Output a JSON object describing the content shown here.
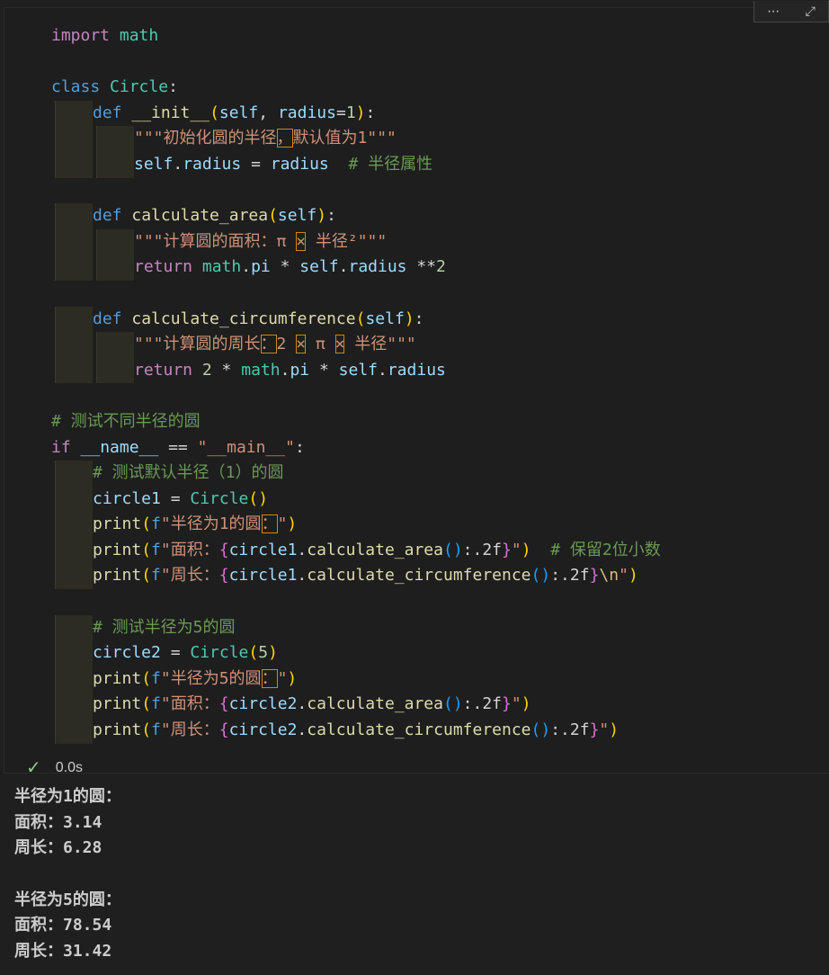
{
  "cell": {
    "toolbar_icons": [
      "more-actions-icon",
      "expand-icon"
    ],
    "code_lines": [
      {
        "guides": 0,
        "tokens": [
          [
            "ctl",
            "import"
          ],
          [
            "op",
            " "
          ],
          [
            "cls",
            "math"
          ]
        ]
      },
      {
        "guides": 0,
        "tokens": []
      },
      {
        "guides": 0,
        "tokens": [
          [
            "kw",
            "class"
          ],
          [
            "op",
            " "
          ],
          [
            "cls",
            "Circle"
          ],
          [
            "op",
            ":"
          ]
        ]
      },
      {
        "guides": 1,
        "tokens": [
          [
            "kw",
            "def"
          ],
          [
            "op",
            " "
          ],
          [
            "fn",
            "__init__"
          ],
          [
            "b1",
            "("
          ],
          [
            "var",
            "self"
          ],
          [
            "op",
            ", "
          ],
          [
            "var",
            "radius"
          ],
          [
            "op",
            "="
          ],
          [
            "num",
            "1"
          ],
          [
            "b1",
            ")"
          ],
          [
            "op",
            ":"
          ]
        ]
      },
      {
        "guides": 2,
        "tokens": [
          [
            "str",
            "\"\"\"初始化圆的半径"
          ],
          [
            "str hl",
            "，"
          ],
          [
            "str",
            "默认值为1\"\"\""
          ]
        ]
      },
      {
        "guides": 2,
        "tokens": [
          [
            "var",
            "self"
          ],
          [
            "op",
            "."
          ],
          [
            "var",
            "radius"
          ],
          [
            "op",
            " = "
          ],
          [
            "var",
            "radius"
          ],
          [
            "op",
            "  "
          ],
          [
            "com",
            "# 半径属性"
          ]
        ]
      },
      {
        "guides": 0,
        "tokens": []
      },
      {
        "guides": 1,
        "tokens": [
          [
            "kw",
            "def"
          ],
          [
            "op",
            " "
          ],
          [
            "fn",
            "calculate_area"
          ],
          [
            "b1",
            "("
          ],
          [
            "var",
            "self"
          ],
          [
            "b1",
            ")"
          ],
          [
            "op",
            ":"
          ]
        ]
      },
      {
        "guides": 2,
        "tokens": [
          [
            "str",
            "\"\"\"计算圆的面积：π "
          ],
          [
            "str hl",
            "×"
          ],
          [
            "str",
            " 半径²\"\"\""
          ]
        ]
      },
      {
        "guides": 2,
        "tokens": [
          [
            "ctl",
            "return"
          ],
          [
            "op",
            " "
          ],
          [
            "cls",
            "math"
          ],
          [
            "op",
            "."
          ],
          [
            "var",
            "pi"
          ],
          [
            "op",
            " * "
          ],
          [
            "var",
            "self"
          ],
          [
            "op",
            "."
          ],
          [
            "var",
            "radius"
          ],
          [
            "op",
            " **"
          ],
          [
            "num",
            "2"
          ]
        ]
      },
      {
        "guides": 0,
        "tokens": []
      },
      {
        "guides": 1,
        "tokens": [
          [
            "kw",
            "def"
          ],
          [
            "op",
            " "
          ],
          [
            "fn",
            "calculate_circumference"
          ],
          [
            "b1",
            "("
          ],
          [
            "var",
            "self"
          ],
          [
            "b1",
            ")"
          ],
          [
            "op",
            ":"
          ]
        ]
      },
      {
        "guides": 2,
        "tokens": [
          [
            "str",
            "\"\"\"计算圆的周长"
          ],
          [
            "str hl",
            "："
          ],
          [
            "str",
            "2 "
          ],
          [
            "str hl",
            "×"
          ],
          [
            "str",
            " π "
          ],
          [
            "str hl",
            "×"
          ],
          [
            "str",
            " 半径\"\"\""
          ]
        ]
      },
      {
        "guides": 2,
        "tokens": [
          [
            "ctl",
            "return"
          ],
          [
            "op",
            " "
          ],
          [
            "num",
            "2"
          ],
          [
            "op",
            " * "
          ],
          [
            "cls",
            "math"
          ],
          [
            "op",
            "."
          ],
          [
            "var",
            "pi"
          ],
          [
            "op",
            " * "
          ],
          [
            "var",
            "self"
          ],
          [
            "op",
            "."
          ],
          [
            "var",
            "radius"
          ]
        ]
      },
      {
        "guides": 0,
        "tokens": []
      },
      {
        "guides": 0,
        "tokens": [
          [
            "com",
            "# 测试不同半径的圆"
          ]
        ]
      },
      {
        "guides": 0,
        "tokens": [
          [
            "ctl",
            "if"
          ],
          [
            "op",
            " "
          ],
          [
            "var",
            "__name__"
          ],
          [
            "op",
            " == "
          ],
          [
            "str",
            "\"__main__\""
          ],
          [
            "op",
            ":"
          ]
        ]
      },
      {
        "guides": 1,
        "tokens": [
          [
            "com",
            "# 测试默认半径（1）的圆"
          ]
        ]
      },
      {
        "guides": 1,
        "tokens": [
          [
            "var",
            "circle1"
          ],
          [
            "op",
            " = "
          ],
          [
            "cls",
            "Circle"
          ],
          [
            "b1",
            "()"
          ]
        ]
      },
      {
        "guides": 1,
        "tokens": [
          [
            "fn",
            "print"
          ],
          [
            "b1",
            "("
          ],
          [
            "kw",
            "f"
          ],
          [
            "str",
            "\"半径为1的圆"
          ],
          [
            "str hl",
            "："
          ],
          [
            "str",
            "\""
          ],
          [
            "b1",
            ")"
          ]
        ]
      },
      {
        "guides": 1,
        "tokens": [
          [
            "fn",
            "print"
          ],
          [
            "b1",
            "("
          ],
          [
            "kw",
            "f"
          ],
          [
            "str",
            "\"面积："
          ],
          [
            "b2",
            "{"
          ],
          [
            "var",
            "circle1"
          ],
          [
            "op",
            "."
          ],
          [
            "fn",
            "calculate_area"
          ],
          [
            "b3",
            "()"
          ],
          [
            "op",
            ":.2f"
          ],
          [
            "b2",
            "}"
          ],
          [
            "str",
            "\""
          ],
          [
            "b1",
            ")"
          ],
          [
            "op",
            "  "
          ],
          [
            "com",
            "# 保留2位小数"
          ]
        ]
      },
      {
        "guides": 1,
        "tokens": [
          [
            "fn",
            "print"
          ],
          [
            "b1",
            "("
          ],
          [
            "kw",
            "f"
          ],
          [
            "str",
            "\"周长："
          ],
          [
            "b2",
            "{"
          ],
          [
            "var",
            "circle1"
          ],
          [
            "op",
            "."
          ],
          [
            "fn",
            "calculate_circumference"
          ],
          [
            "b3",
            "()"
          ],
          [
            "op",
            ":.2f"
          ],
          [
            "b2",
            "}"
          ],
          [
            "esc",
            "\\n"
          ],
          [
            "str",
            "\""
          ],
          [
            "b1",
            ")"
          ]
        ]
      },
      {
        "guides": 0,
        "tokens": []
      },
      {
        "guides": 1,
        "tokens": [
          [
            "com",
            "# 测试半径为5的圆"
          ]
        ]
      },
      {
        "guides": 1,
        "tokens": [
          [
            "var",
            "circle2"
          ],
          [
            "op",
            " = "
          ],
          [
            "cls",
            "Circle"
          ],
          [
            "b1",
            "("
          ],
          [
            "num",
            "5"
          ],
          [
            "b1",
            ")"
          ]
        ]
      },
      {
        "guides": 1,
        "tokens": [
          [
            "fn",
            "print"
          ],
          [
            "b1",
            "("
          ],
          [
            "kw",
            "f"
          ],
          [
            "str",
            "\"半径为5的圆"
          ],
          [
            "str hl",
            "："
          ],
          [
            "str",
            "\""
          ],
          [
            "b1",
            ")"
          ]
        ]
      },
      {
        "guides": 1,
        "tokens": [
          [
            "fn",
            "print"
          ],
          [
            "b1",
            "("
          ],
          [
            "kw",
            "f"
          ],
          [
            "str",
            "\"面积："
          ],
          [
            "b2",
            "{"
          ],
          [
            "var",
            "circle2"
          ],
          [
            "op",
            "."
          ],
          [
            "fn",
            "calculate_area"
          ],
          [
            "b3",
            "()"
          ],
          [
            "op",
            ":.2f"
          ],
          [
            "b2",
            "}"
          ],
          [
            "str",
            "\""
          ],
          [
            "b1",
            ")"
          ]
        ]
      },
      {
        "guides": 1,
        "tokens": [
          [
            "fn",
            "print"
          ],
          [
            "b1",
            "("
          ],
          [
            "kw",
            "f"
          ],
          [
            "str",
            "\"周长："
          ],
          [
            "b2",
            "{"
          ],
          [
            "var",
            "circle2"
          ],
          [
            "op",
            "."
          ],
          [
            "fn",
            "calculate_circumference"
          ],
          [
            "b3",
            "()"
          ],
          [
            "op",
            ":.2f"
          ],
          [
            "b2",
            "}"
          ],
          [
            "str",
            "\""
          ],
          [
            "b1",
            ")"
          ]
        ]
      }
    ],
    "status": {
      "icon": "check-icon",
      "duration": "0.0s"
    }
  },
  "output": {
    "lines": [
      "半径为1的圆：",
      "面积：3.14",
      "周长：6.28",
      "",
      "半径为5的圆：",
      "面积：78.54",
      "周长：31.42"
    ]
  }
}
